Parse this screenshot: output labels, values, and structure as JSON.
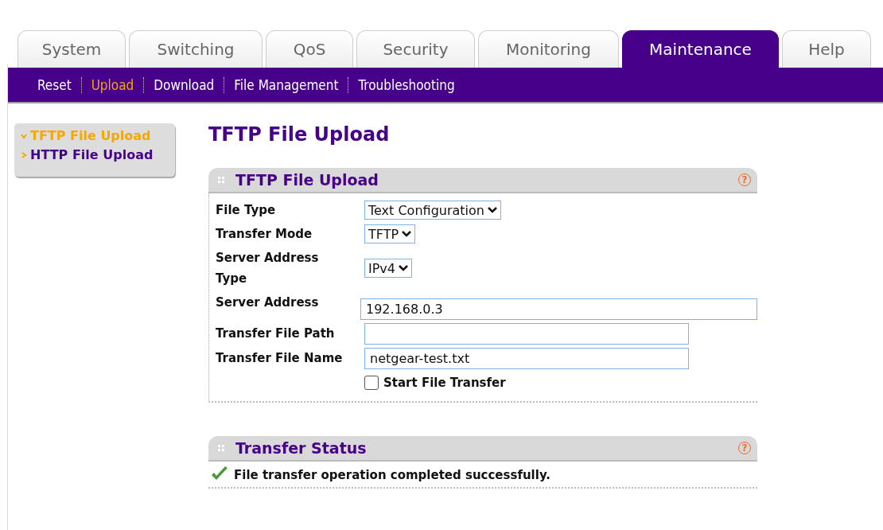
{
  "tabs": [
    {
      "label": "System",
      "selected": false
    },
    {
      "label": "Switching",
      "selected": false
    },
    {
      "label": "QoS",
      "selected": false
    },
    {
      "label": "Security",
      "selected": false
    },
    {
      "label": "Monitoring",
      "selected": false
    },
    {
      "label": "Maintenance",
      "selected": true
    },
    {
      "label": "Help",
      "selected": false
    }
  ],
  "subnav": [
    {
      "label": "Reset",
      "selected": false
    },
    {
      "label": "Upload",
      "selected": true
    },
    {
      "label": "Download",
      "selected": false
    },
    {
      "label": "File Management",
      "selected": false
    },
    {
      "label": "Troubleshooting",
      "selected": false
    }
  ],
  "sidebar": {
    "items": [
      {
        "label": "TFTP File Upload",
        "selected": true
      },
      {
        "label": "HTTP File Upload",
        "selected": false
      }
    ]
  },
  "page_title": "TFTP File Upload",
  "upload_panel": {
    "title": "TFTP File Upload",
    "help": "?",
    "fields": [
      {
        "kind": "select",
        "label": "File Type",
        "value": "Text Configuration"
      },
      {
        "kind": "select",
        "label": "Transfer Mode",
        "value": "TFTP"
      },
      {
        "kind": "select",
        "label": "Server Address Type",
        "value": "IPv4"
      },
      {
        "kind": "wide-input",
        "label": "Server Address",
        "value": "192.168.0.3"
      },
      {
        "kind": "input",
        "label": "Transfer File Path"
      },
      {
        "kind": "input",
        "label": "Transfer File Name",
        "value": "netgear-test.txt"
      },
      {
        "kind": "checkbox",
        "label": "Start File Transfer",
        "checked": false
      }
    ]
  },
  "status_panel": {
    "title": "Transfer Status",
    "help": "?",
    "message": "File transfer operation completed successfully."
  }
}
